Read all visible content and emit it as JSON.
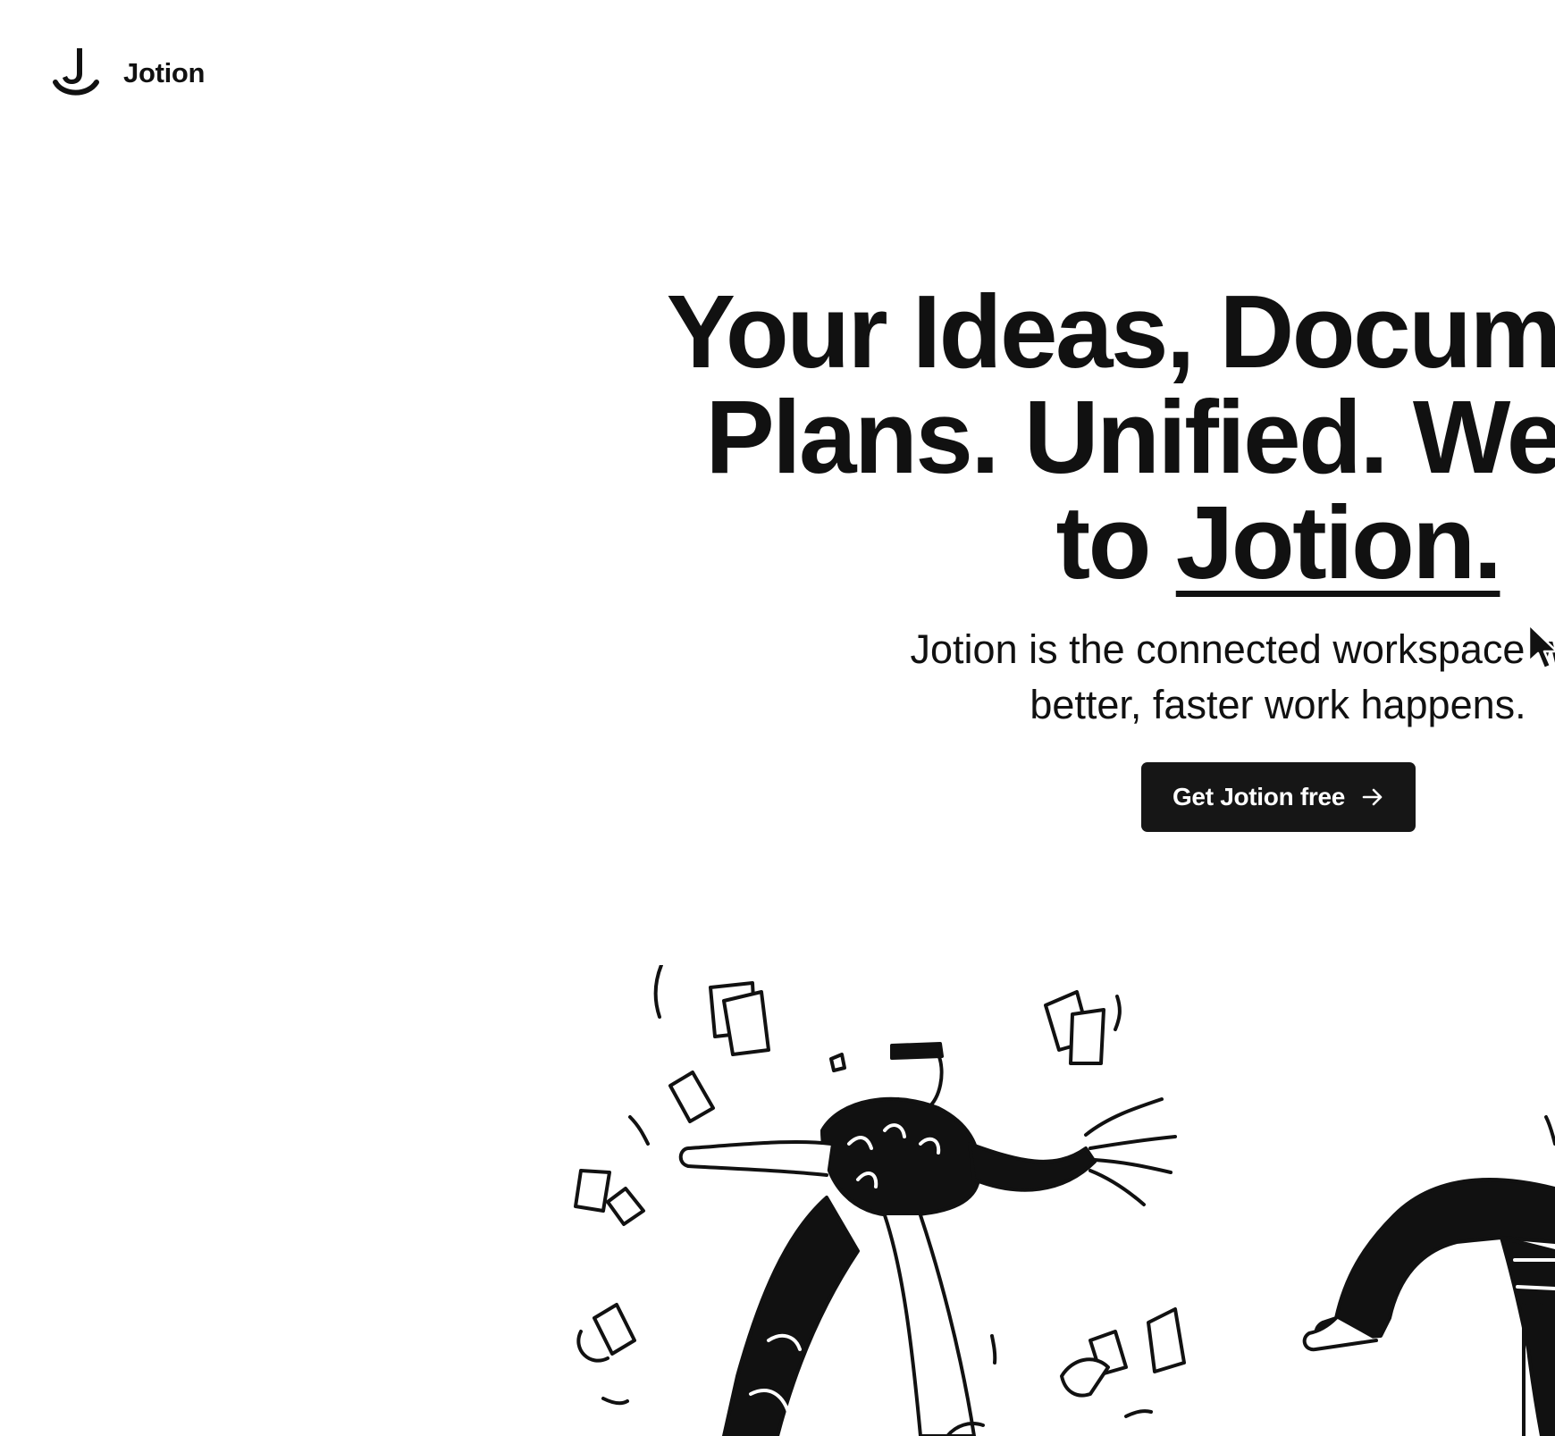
{
  "nav": {
    "brand": "Jotion",
    "logo_icon": "jotion-logo-icon"
  },
  "hero": {
    "headline_line1": "Your Ideas, Documents, &",
    "headline_line2": "Plans. Unified. Welcome",
    "headline_line3_prefix": "to ",
    "headline_brand": "Jotion.",
    "subhead_line1": "Jotion is the connected workspace where",
    "subhead_line2": "better, faster work happens.",
    "cta_label": "Get Jotion free",
    "cta_icon": "arrow-right-icon"
  },
  "illustration": {
    "icon": "people-juggling-papers-illustration"
  },
  "colors": {
    "background": "#ffffff",
    "text": "#111111",
    "button_bg": "#161616",
    "button_text": "#ffffff"
  }
}
